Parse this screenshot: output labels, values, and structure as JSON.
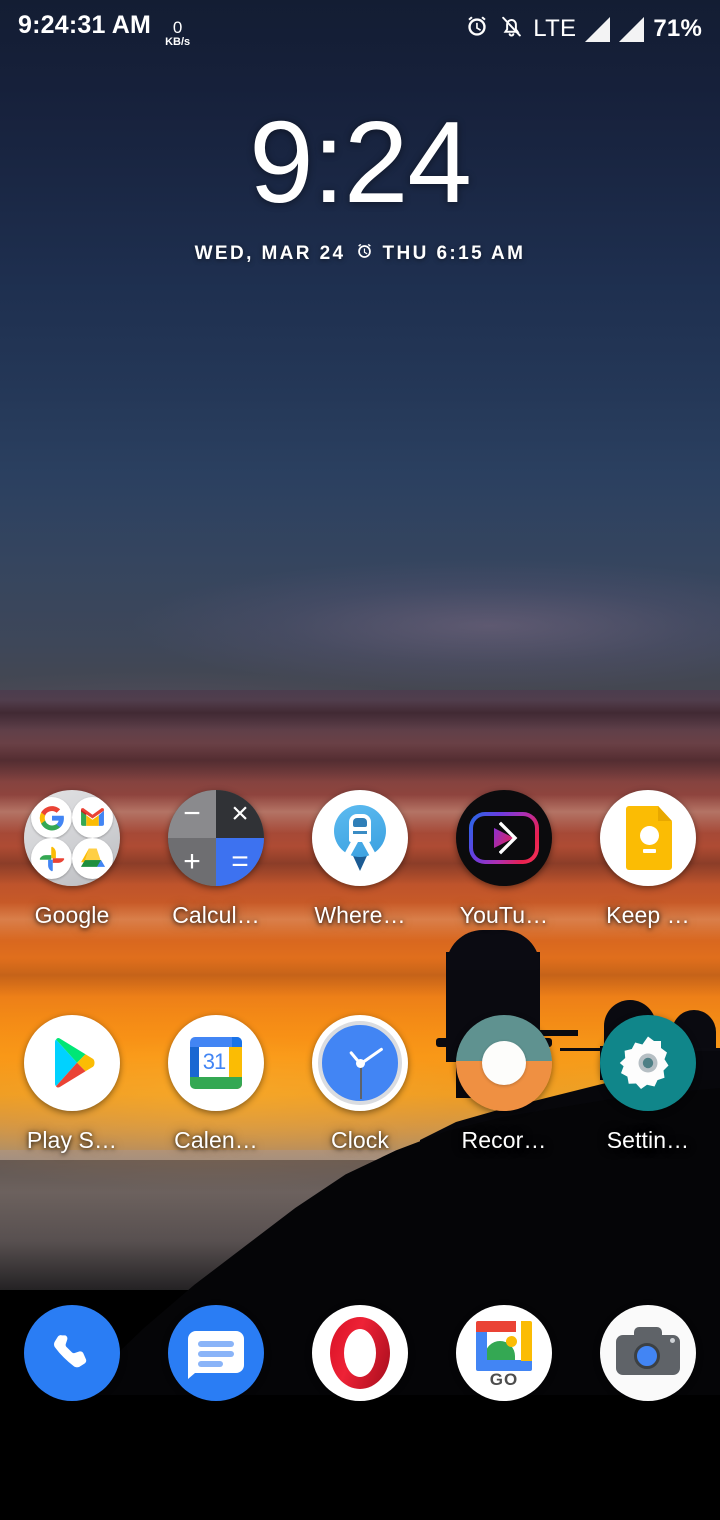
{
  "status_bar": {
    "clock": "9:24:31 AM",
    "net_speed_value": "0",
    "net_speed_unit": "KB/s",
    "alarm_icon": "alarm-clock-icon",
    "mute_icon": "bell-muted-icon",
    "network_type": "LTE",
    "signal_icon_1": "signal-bars-icon",
    "signal_icon_2": "signal-bars-icon",
    "battery": "71%"
  },
  "clock_widget": {
    "time": "9:24",
    "date": "WED, MAR 24",
    "alarm_icon": "alarm-clock-icon",
    "next_alarm": "THU 6:15 AM"
  },
  "home_rows": [
    {
      "apps": [
        {
          "label": "Google",
          "icon": "google-folder-icon",
          "full_name": "Google"
        },
        {
          "label": "Calcul…",
          "icon": "calculator-icon",
          "full_name": "Calculator"
        },
        {
          "label": "Where…",
          "icon": "where-is-my-train-icon",
          "full_name": "Where is my Train"
        },
        {
          "label": "YouTu…",
          "icon": "youtube-vanced-icon",
          "full_name": "YouTube Vanced"
        },
        {
          "label": "Keep …",
          "icon": "google-keep-icon",
          "full_name": "Keep Notes"
        }
      ]
    },
    {
      "apps": [
        {
          "label": "Play S…",
          "icon": "play-store-icon",
          "full_name": "Play Store"
        },
        {
          "label": "Calen…",
          "icon": "google-calendar-icon",
          "full_name": "Calendar"
        },
        {
          "label": "Clock",
          "icon": "clock-icon",
          "full_name": "Clock"
        },
        {
          "label": "Recor…",
          "icon": "recorder-icon",
          "full_name": "Recorder"
        },
        {
          "label": "Settin…",
          "icon": "settings-gear-icon",
          "full_name": "Settings"
        }
      ]
    }
  ],
  "google_folder": {
    "sub_icons": [
      "google-search-icon",
      "gmail-icon",
      "google-photos-icon",
      "google-drive-icon"
    ],
    "letters": {
      "g": "G",
      "m": "M"
    }
  },
  "calculator": {
    "keys": [
      "−",
      "×",
      "+",
      "="
    ],
    "colors": {
      "minus_bg": "#8a8a8d",
      "times_bg": "#303236",
      "plus_bg": "#6e6e71",
      "equals_bg": "#3d72f0"
    }
  },
  "calendar": {
    "day_number": "31"
  },
  "gallery_go": {
    "badge": "GO"
  },
  "dock": {
    "apps": [
      {
        "icon": "phone-icon",
        "full_name": "Phone"
      },
      {
        "icon": "messages-icon",
        "full_name": "Messages"
      },
      {
        "icon": "opera-icon",
        "full_name": "Opera"
      },
      {
        "icon": "gallery-go-icon",
        "full_name": "Gallery Go"
      },
      {
        "icon": "camera-icon",
        "full_name": "Camera"
      }
    ]
  },
  "colors": {
    "accent_blue": "#4285f4",
    "keep_yellow": "#fbbc04",
    "settings_teal": "#10868a",
    "recorder_orange": "#ef9042",
    "recorder_teal": "#5f9290",
    "opera_red": "#ee2236",
    "text_white": "#ffffff"
  },
  "wallpaper": {
    "description": "night-to-sunset sky over observatory mountain silhouette",
    "sky_top": "#131d33",
    "sunset_mid": "#d66520",
    "sunset_bright": "#f89b18",
    "silhouette": "#050507"
  }
}
